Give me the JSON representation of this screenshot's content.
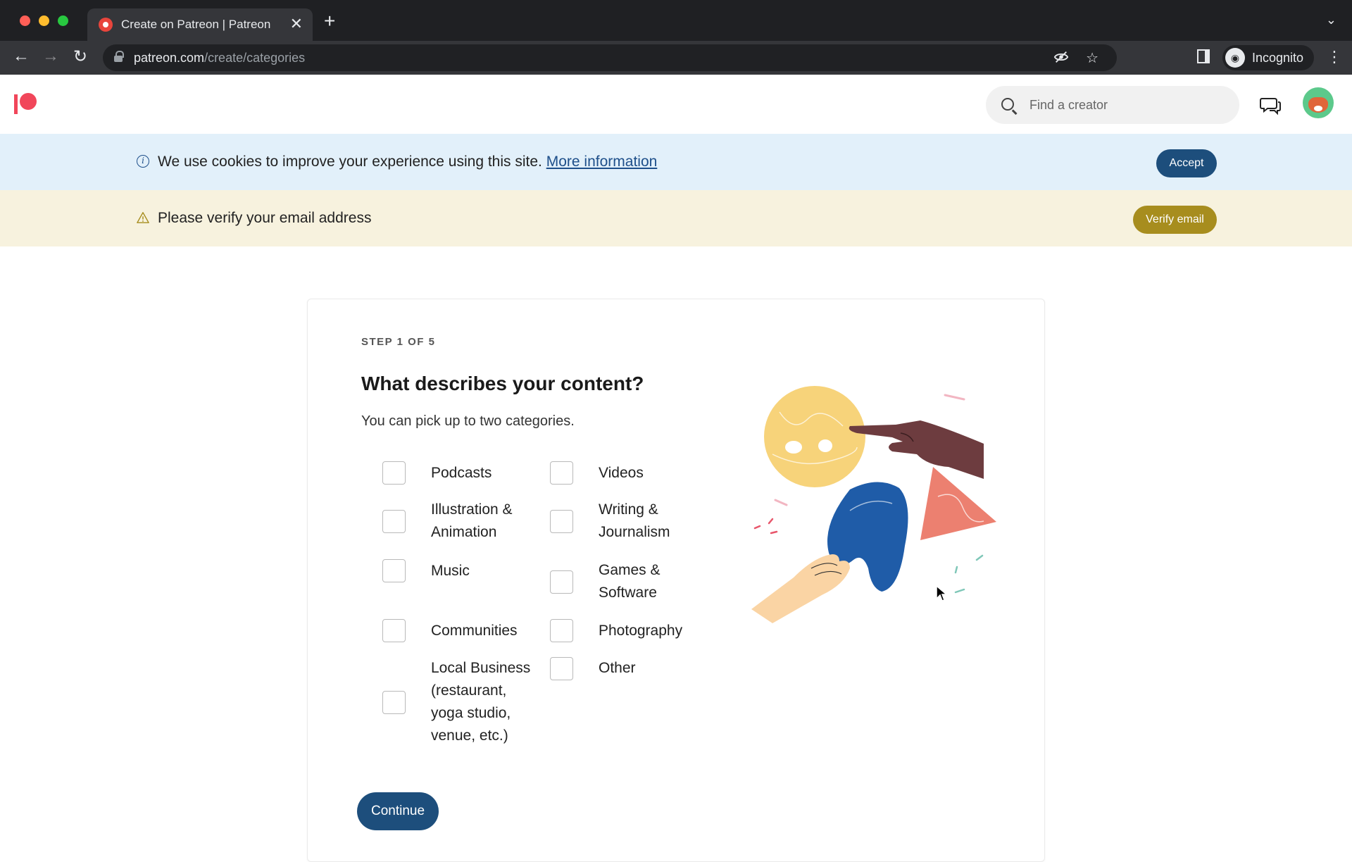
{
  "browser": {
    "tab_title": "Create on Patreon | Patreon",
    "new_tab_symbol": "+",
    "close_symbol": "✕",
    "url_domain": "patreon.com",
    "url_path": "/create/categories",
    "incognito_label": "Incognito"
  },
  "header": {
    "search_placeholder": "Find a creator"
  },
  "cookie_banner": {
    "text": "We use cookies to improve your experience using this site.",
    "link": "More information",
    "accept_label": "Accept"
  },
  "verify_banner": {
    "text": "Please verify your email address",
    "button_label": "Verify email"
  },
  "form": {
    "step": "STEP 1 OF 5",
    "title": "What describes your content?",
    "subtitle": "You can pick up to two categories.",
    "categories": [
      {
        "label": "Podcasts",
        "checked": false
      },
      {
        "label": "Videos",
        "checked": false
      },
      {
        "label": "Illustration & Animation",
        "checked": false
      },
      {
        "label": "Writing & Journalism",
        "checked": false
      },
      {
        "label": "Music",
        "checked": false
      },
      {
        "label": "Games & Software",
        "checked": false
      },
      {
        "label": "Communities",
        "checked": false
      },
      {
        "label": "Photography",
        "checked": false
      },
      {
        "label": "Local Business (restaurant, yoga studio, venue, etc.)",
        "checked": false
      },
      {
        "label": "Other",
        "checked": false
      }
    ],
    "continue_label": "Continue"
  },
  "colors": {
    "brand": "#f1465a",
    "primary_button": "#1d4e7c",
    "verify_button": "#a78d1e",
    "cookie_bg": "#e2f0fa",
    "verify_bg": "#f7f2de"
  }
}
